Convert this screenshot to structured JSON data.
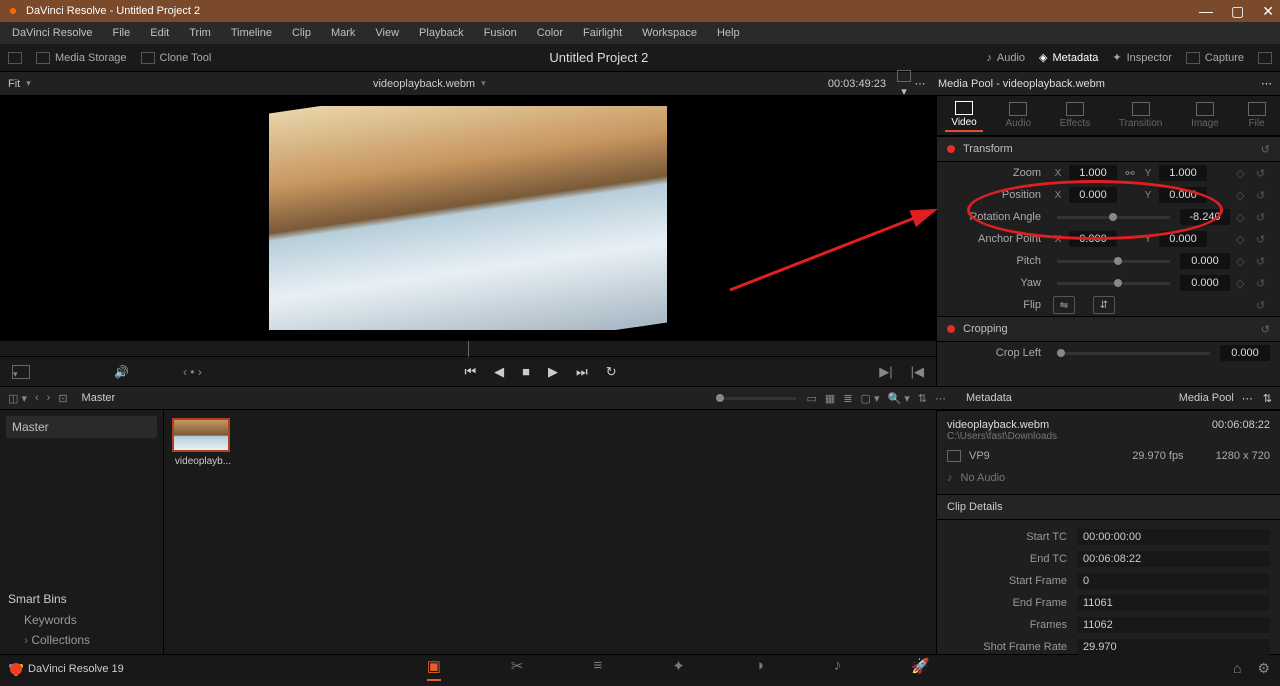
{
  "app": {
    "name": "DaVinci Resolve",
    "project": "Untitled Project 2",
    "version_label": "DaVinci Resolve 19"
  },
  "menubar": [
    "DaVinci Resolve",
    "File",
    "Edit",
    "Trim",
    "Timeline",
    "Clip",
    "Mark",
    "View",
    "Playback",
    "Fusion",
    "Color",
    "Fairlight",
    "Workspace",
    "Help"
  ],
  "toolbar": {
    "media_storage": "Media Storage",
    "clone_tool": "Clone Tool",
    "center_title": "Untitled Project 2",
    "audio": "Audio",
    "metadata": "Metadata",
    "inspector": "Inspector",
    "capture": "Capture"
  },
  "viewer": {
    "fit_label": "Fit",
    "filename": "videoplayback.webm",
    "timecode": "00:03:49:23",
    "media_pool_header": "Media Pool - videoplayback.webm"
  },
  "inspector_tabs": [
    "Video",
    "Audio",
    "Effects",
    "Transition",
    "Image",
    "File"
  ],
  "transform": {
    "title": "Transform",
    "zoom": {
      "label": "Zoom",
      "x": "1.000",
      "y": "1.000"
    },
    "position": {
      "label": "Position",
      "x": "0.000",
      "y": "0.000"
    },
    "rotation": {
      "label": "Rotation Angle",
      "value": "-8.240"
    },
    "anchor": {
      "label": "Anchor Point",
      "x": "0.000",
      "y": "0.000"
    },
    "pitch": {
      "label": "Pitch",
      "value": "0.000"
    },
    "yaw": {
      "label": "Yaw",
      "value": "0.000"
    },
    "flip": {
      "label": "Flip"
    }
  },
  "cropping": {
    "title": "Cropping",
    "crop_left_label": "Crop Left",
    "crop_left_value": "0.000"
  },
  "browser": {
    "master": "Master",
    "clip_label": "videoplayb...",
    "smart_bins": "Smart Bins",
    "keywords": "Keywords",
    "collections": "Collections"
  },
  "metadata": {
    "title": "Metadata",
    "media_pool": "Media Pool",
    "filename": "videoplayback.webm",
    "path": "C:\\Users\\fast\\Downloads",
    "duration": "00:06:08:22",
    "codec": "VP9",
    "fps": "29.970 fps",
    "resolution": "1280 x 720",
    "no_audio": "No Audio",
    "clip_details": "Clip Details",
    "details": {
      "start_tc": {
        "label": "Start TC",
        "value": "00:00:00:00"
      },
      "end_tc": {
        "label": "End TC",
        "value": "00:06:08:22"
      },
      "start_frame": {
        "label": "Start Frame",
        "value": "0"
      },
      "end_frame": {
        "label": "End Frame",
        "value": "11061"
      },
      "frames": {
        "label": "Frames",
        "value": "11062"
      },
      "shot_fr": {
        "label": "Shot Frame Rate",
        "value": "29.970"
      }
    }
  },
  "axis": {
    "x": "X",
    "y": "Y"
  }
}
